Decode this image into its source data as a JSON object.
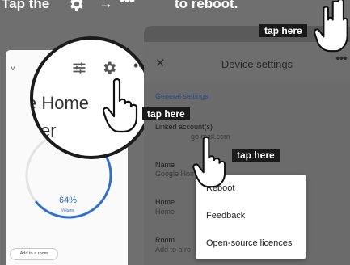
{
  "headline": {
    "part1": "Tap the",
    "arrow": "→",
    "dots": "•••",
    "part2": "to reboot."
  },
  "left_phone": {
    "chevron": "˅",
    "more": "⋮",
    "gauge_value": 64,
    "gauge_label": "64%",
    "gauge_sub": "Volume",
    "add_room": "Add to a room",
    "accent": "#2f6fd1"
  },
  "magnifier": {
    "line1": "e Home",
    "line2": "ker",
    "more": "•••"
  },
  "right_phone": {
    "close": "✕",
    "title": "Device settings",
    "more": "•••",
    "section": "General settings",
    "linked_label": "Linked account(s)",
    "linked_value": "go        mail.com",
    "name_label": "Name",
    "name_value": "Google Home",
    "home_label": "Home",
    "home_value": "Home",
    "room_label": "Room",
    "room_value": "Add to a ro"
  },
  "menu": {
    "items": [
      "Reboot",
      "Feedback",
      "Open-source licences"
    ]
  },
  "callouts": {
    "tap_here_1": "tap here",
    "tap_here_2": "tap here",
    "tap_here_3": "tap here"
  },
  "colors": {
    "overlay": "#6f6f6f",
    "callout_bg": "#1a1a1a",
    "link_blue": "#264b86"
  }
}
